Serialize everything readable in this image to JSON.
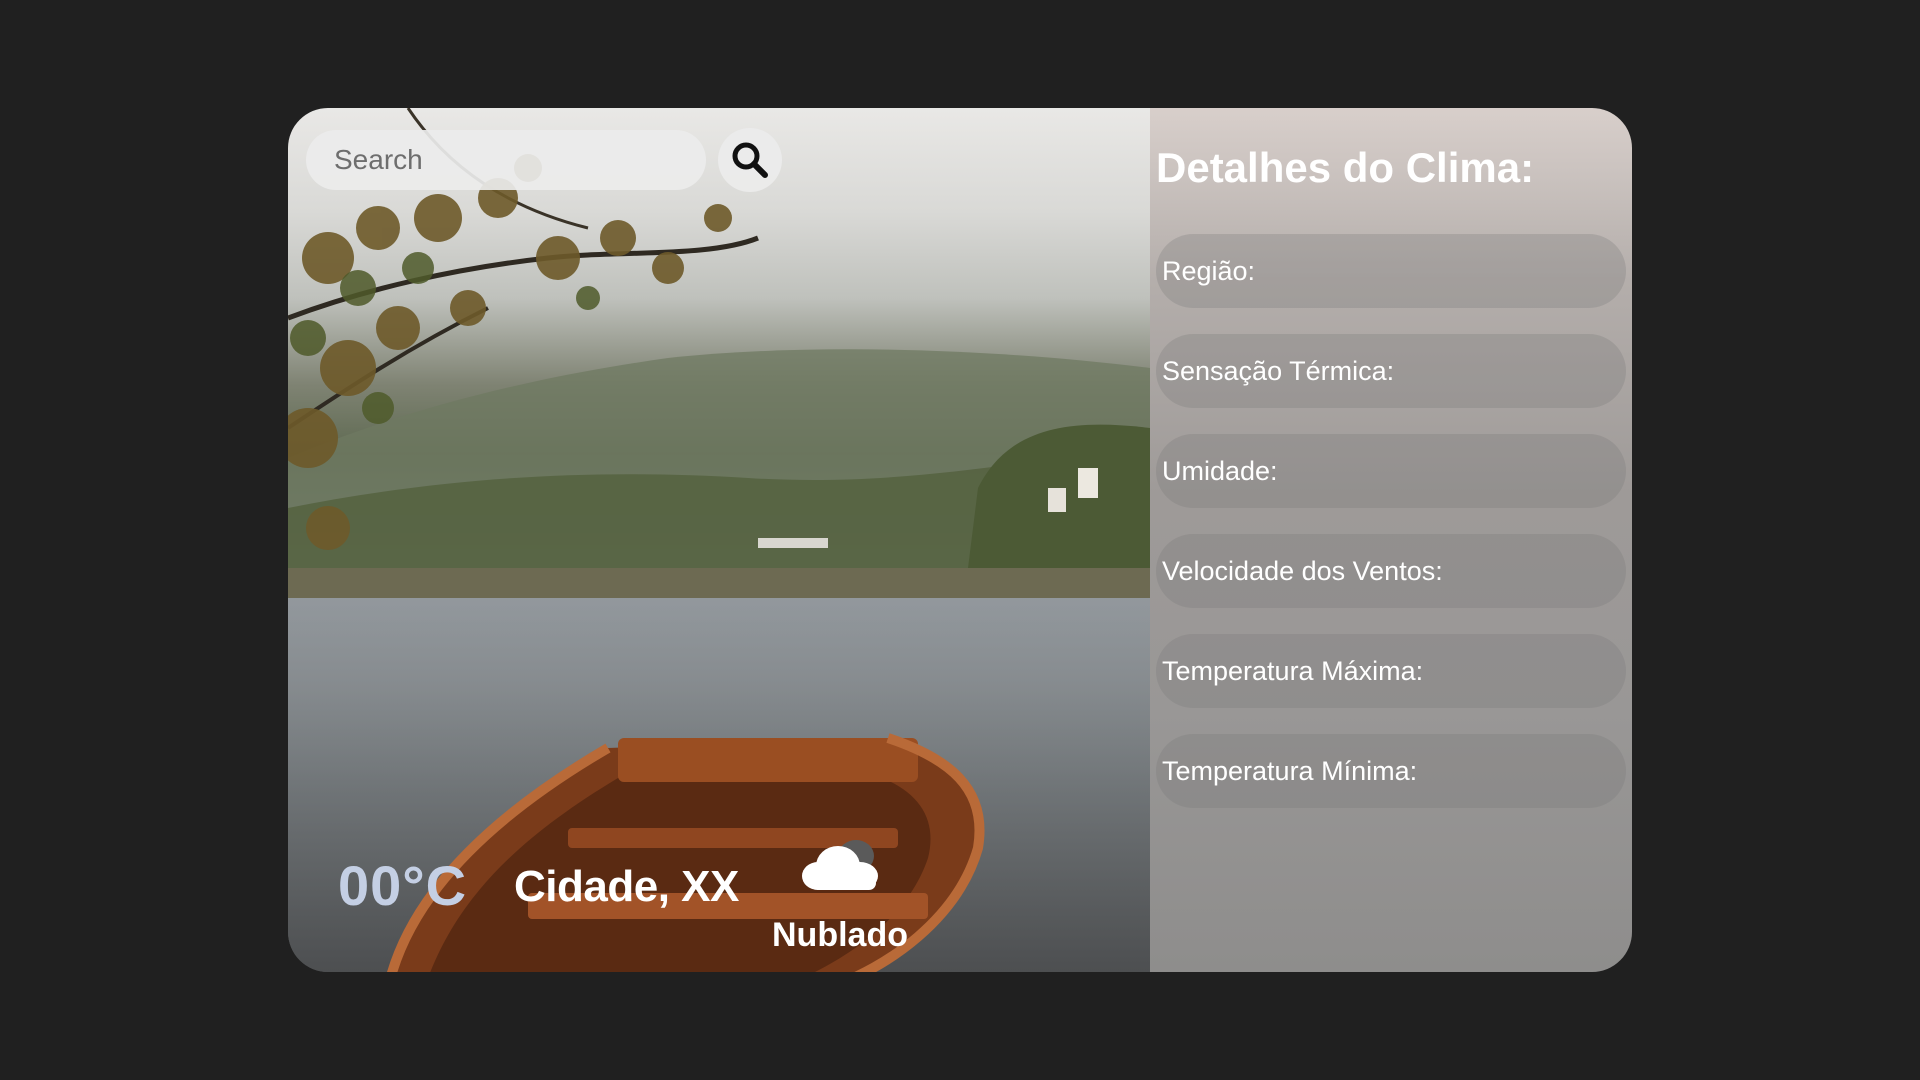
{
  "search": {
    "placeholder": "Search"
  },
  "weather": {
    "temperature": "00°C",
    "city": "Cidade, XX",
    "condition": "Nublado",
    "condition_icon": "cloud-icon"
  },
  "details": {
    "title": "Detalhes do Clima:",
    "items": [
      {
        "label": "Região:"
      },
      {
        "label": "Sensação Térmica:"
      },
      {
        "label": "Umidade:"
      },
      {
        "label": "Velocidade dos Ventos:"
      },
      {
        "label": "Temperatura Máxima:"
      },
      {
        "label": "Temperatura Mínima:"
      }
    ]
  },
  "colors": {
    "page_background": "#202020",
    "temperature_text": "#c4cfe4",
    "text": "#ffffff"
  }
}
